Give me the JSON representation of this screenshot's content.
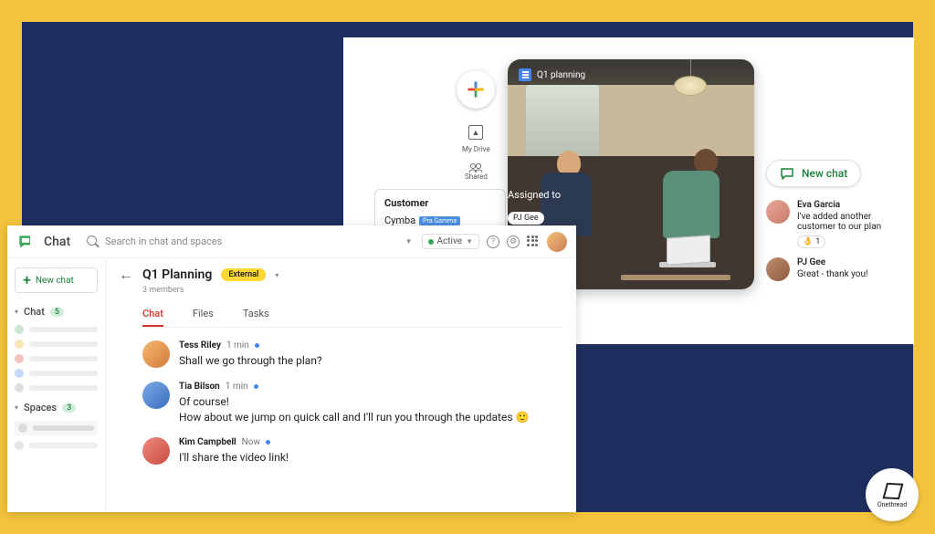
{
  "colors": {
    "yellow": "#f3c33c",
    "navy": "#1e2f5f",
    "green": "#188038",
    "red": "#d93025",
    "blue": "#4285f4"
  },
  "topRight": {
    "quickDrive": {
      "myDrive": "My Drive",
      "shared": "Shared"
    },
    "customer": {
      "header": "Customer",
      "value": "Cymba",
      "tag": "Pra Gamma"
    },
    "assigned": {
      "header": "Assigned to",
      "pill": "PJ Gee",
      "redTag": "PJ Gee"
    },
    "doc": {
      "title": "Q1 planning"
    }
  },
  "newChatPanel": {
    "button": "New chat",
    "items": [
      {
        "name": "Eva Garcia",
        "text": "I've added another customer to our plan",
        "reaction": "👌",
        "count": "1"
      },
      {
        "name": "PJ Gee",
        "text": "Great - thank you!"
      }
    ]
  },
  "chatWindow": {
    "brand": "Chat",
    "searchPlaceholder": "Search in chat and spaces",
    "status": "Active",
    "sidebar": {
      "newChat": "New chat",
      "sections": [
        {
          "label": "Chat",
          "badge": "5"
        },
        {
          "label": "Spaces",
          "badge": "3"
        }
      ]
    },
    "header": {
      "title": "Q1 Planning",
      "badge": "External",
      "members": "3 members"
    },
    "tabs": [
      {
        "label": "Chat",
        "active": true
      },
      {
        "label": "Files",
        "active": false
      },
      {
        "label": "Tasks",
        "active": false
      }
    ],
    "messages": [
      {
        "name": "Tess Riley",
        "time": "1 min",
        "body": "Shall we go through the plan?",
        "avatar": "orange"
      },
      {
        "name": "Tia Bilson",
        "time": "1 min",
        "body": "Of course!\nHow about we jump on quick call and I'll run you through the updates 🙂",
        "avatar": "blue"
      },
      {
        "name": "Kim Campbell",
        "time": "Now",
        "body": "I'll share the video link!",
        "avatar": "red"
      }
    ]
  },
  "branding": {
    "label": "Onethread"
  }
}
